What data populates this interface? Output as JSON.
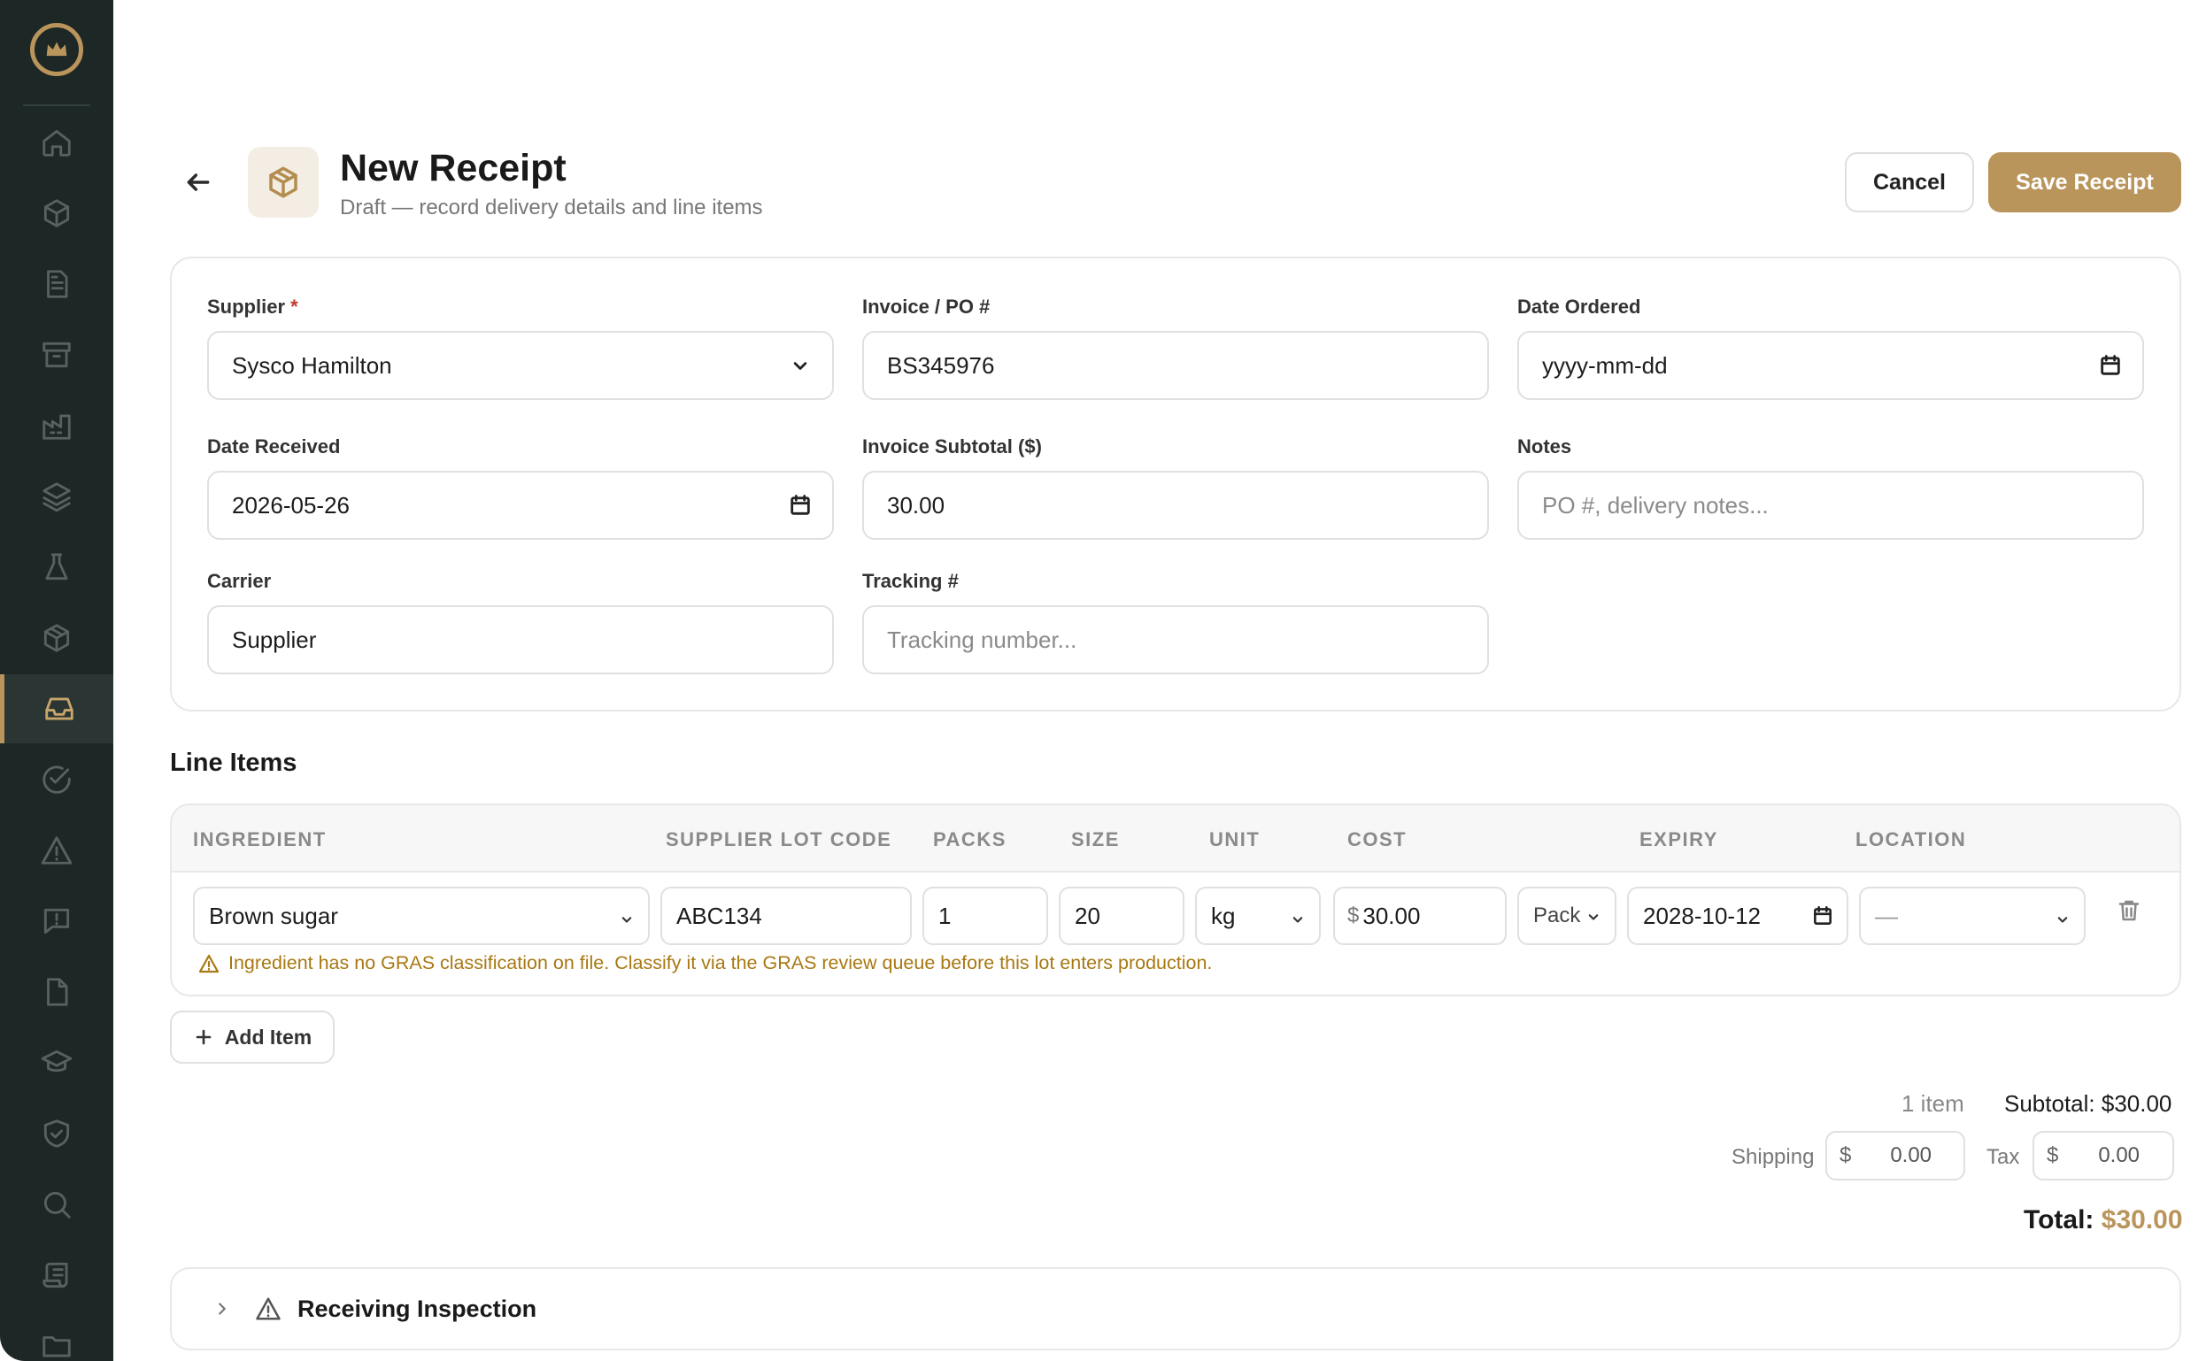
{
  "header": {
    "title": "New Receipt",
    "subtitle": "Draft — record delivery details and line items",
    "cancel_label": "Cancel",
    "save_label": "Save Receipt"
  },
  "form": {
    "supplier": {
      "label": "Supplier",
      "required_mark": "*",
      "value": "Sysco Hamilton"
    },
    "invoice": {
      "label": "Invoice / PO #",
      "value": "BS345976"
    },
    "date_ordered": {
      "label": "Date Ordered",
      "value": "yyyy-mm-dd"
    },
    "date_received": {
      "label": "Date Received",
      "value": "2026-05-26"
    },
    "invoice_subtotal": {
      "label": "Invoice Subtotal ($)",
      "value": "30.00"
    },
    "notes": {
      "label": "Notes",
      "placeholder": "PO #, delivery notes..."
    },
    "carrier": {
      "label": "Carrier",
      "value": "Supplier"
    },
    "tracking": {
      "label": "Tracking #",
      "placeholder": "Tracking number..."
    }
  },
  "line_items": {
    "title": "Line Items",
    "columns": [
      "INGREDIENT",
      "SUPPLIER LOT CODE",
      "PACKS",
      "SIZE",
      "UNIT",
      "COST",
      "EXPIRY",
      "LOCATION"
    ],
    "rows": [
      {
        "ingredient": "Brown sugar",
        "lot_code": "ABC134",
        "packs": "1",
        "size": "20",
        "unit": "kg",
        "cost_symbol": "$",
        "cost": "30.00",
        "cost_basis": "Pack",
        "expiry": "2028-10-12",
        "location": "—",
        "warning": "Ingredient has no GRAS classification on file. Classify it via the GRAS review queue before this lot enters production."
      }
    ],
    "add_label": "Add Item"
  },
  "totals": {
    "item_count": "1 item",
    "subtotal": "Subtotal: $30.00",
    "shipping_label": "Shipping",
    "shipping_symbol": "$",
    "shipping_value": "0.00",
    "tax_label": "Tax",
    "tax_symbol": "$",
    "tax_value": "0.00",
    "total_label": "Total:",
    "total_value": "$30.00"
  },
  "inspection": {
    "title": "Receiving Inspection"
  },
  "colors": {
    "accent": "#b9955c",
    "sidebar": "#1d2726",
    "warning": "#a87812"
  },
  "sidebar_icons": [
    "home-icon",
    "box-icon",
    "document-icon",
    "archive-icon",
    "factory-icon",
    "layers-icon",
    "flask-icon",
    "package-icon",
    "inbox-icon",
    "check-circle-icon",
    "alert-triangle-icon",
    "message-alert-icon",
    "file-icon",
    "graduation-cap-icon",
    "shield-check-icon",
    "search-icon",
    "scroll-icon",
    "folder-icon"
  ]
}
